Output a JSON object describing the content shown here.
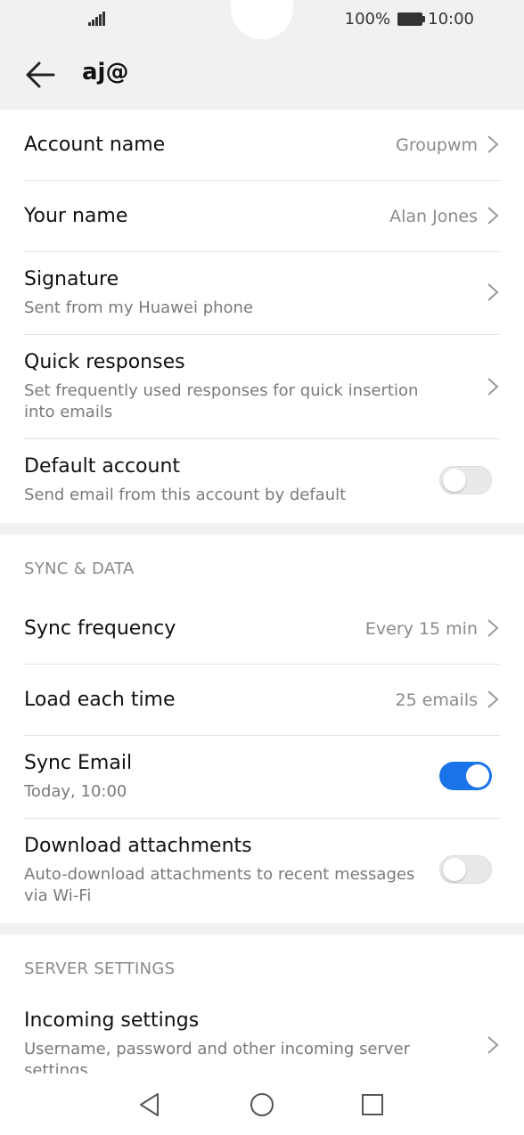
{
  "status": {
    "battery": "100%",
    "time": "10:00"
  },
  "header": {
    "title": "aj@"
  },
  "account": {
    "account_name": {
      "title": "Account name",
      "value": "Groupwm"
    },
    "your_name": {
      "title": "Your name",
      "value": "Alan Jones"
    },
    "signature": {
      "title": "Signature",
      "subtitle": "Sent from my Huawei phone"
    },
    "quick_responses": {
      "title": "Quick responses",
      "subtitle": "Set frequently used responses for quick insertion into emails"
    },
    "default_account": {
      "title": "Default account",
      "subtitle": "Send email from this account by default",
      "enabled": false
    }
  },
  "sync_data": {
    "label": "SYNC & DATA",
    "sync_frequency": {
      "title": "Sync frequency",
      "value": "Every 15 min"
    },
    "load_each_time": {
      "title": "Load each time",
      "value": "25 emails"
    },
    "sync_email": {
      "title": "Sync Email",
      "subtitle": "Today, 10:00",
      "enabled": true
    },
    "download_attachments": {
      "title": "Download attachments",
      "subtitle": "Auto-download attachments to recent messages via Wi-Fi",
      "enabled": false
    }
  },
  "server_settings": {
    "label": "SERVER SETTINGS",
    "incoming": {
      "title": "Incoming settings",
      "subtitle": "Username, password and other incoming server settings"
    }
  },
  "colors": {
    "accent": "#1a73e8",
    "header_bg": "#f1f1f1"
  }
}
